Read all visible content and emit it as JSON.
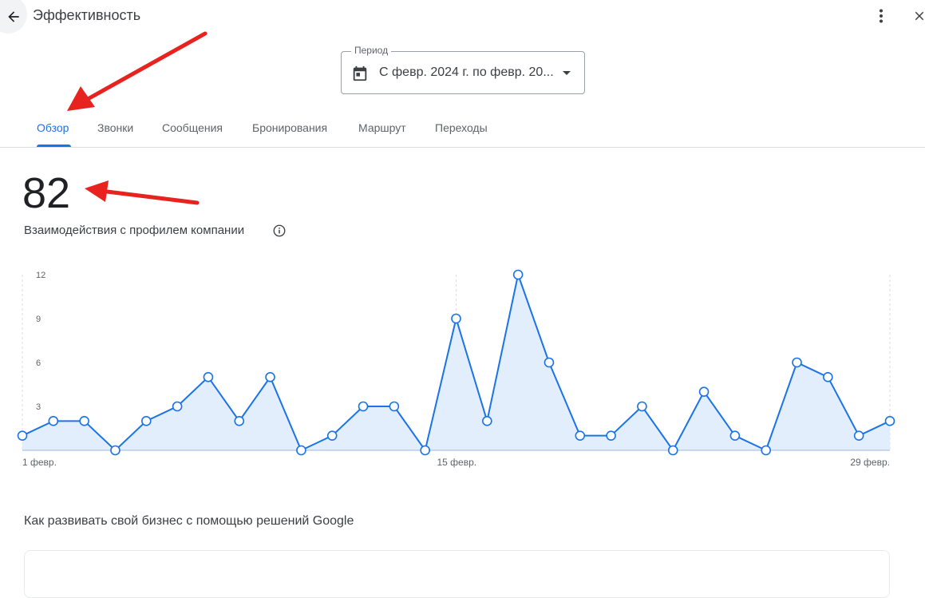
{
  "header": {
    "title": "Эффективность",
    "back_icon": "arrow-back-icon",
    "more_icon": "more-vert-icon",
    "close_icon": "close-icon"
  },
  "period": {
    "label": "Период",
    "value": "С февр. 2024 г. по февр. 20..."
  },
  "tabs": [
    {
      "label": "Обзор",
      "active": true
    },
    {
      "label": "Звонки",
      "active": false
    },
    {
      "label": "Сообщения",
      "active": false
    },
    {
      "label": "Бронирования",
      "active": false
    },
    {
      "label": "Маршрут",
      "active": false
    },
    {
      "label": "Переходы",
      "active": false
    }
  ],
  "metric": {
    "value": "82",
    "label": "Взаимодействия с профилем компании"
  },
  "chart_data": {
    "type": "area",
    "x": [
      1,
      2,
      3,
      4,
      5,
      6,
      7,
      8,
      9,
      10,
      11,
      12,
      13,
      14,
      15,
      16,
      17,
      18,
      19,
      20,
      21,
      22,
      23,
      24,
      25,
      26,
      27,
      28,
      29
    ],
    "values": [
      1,
      2,
      2,
      0,
      2,
      3,
      5,
      2,
      5,
      0,
      1,
      3,
      3,
      0,
      9,
      2,
      12,
      6,
      1,
      1,
      3,
      0,
      4,
      1,
      0,
      6,
      5,
      1,
      2
    ],
    "x_tick_labels": [
      "1 февр.",
      "15 февр.",
      "29 февр."
    ],
    "y_ticks": [
      3,
      6,
      9,
      12
    ],
    "ylim": [
      0,
      12
    ],
    "color": "#1a73e8",
    "fill": "#e3eefc"
  },
  "section": {
    "title": "Как развивать свой бизнес с помощью решений Google"
  },
  "colors": {
    "accent": "#1a73e8",
    "annotation": "#e8231f"
  }
}
